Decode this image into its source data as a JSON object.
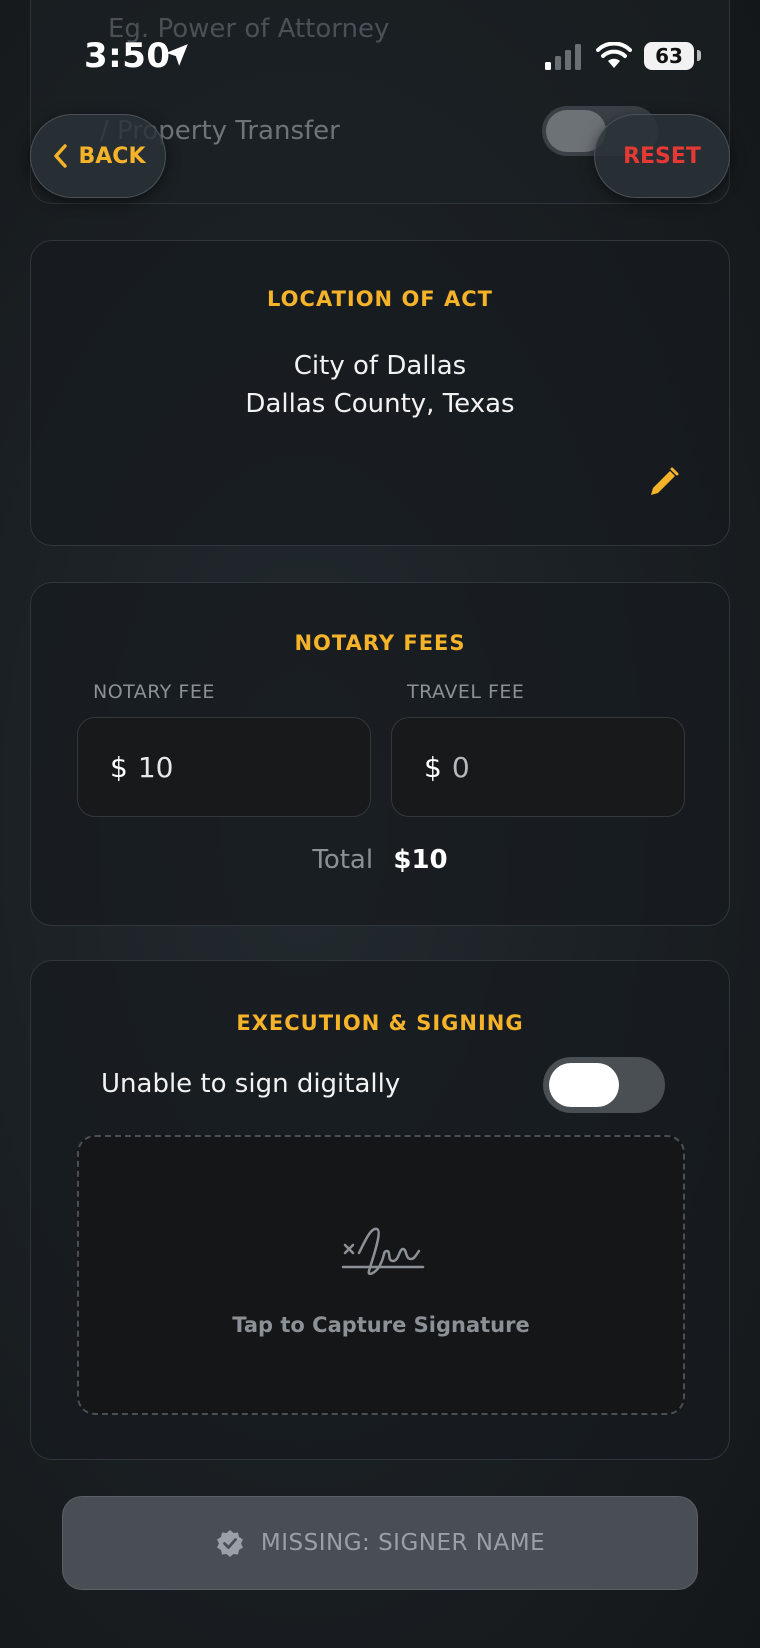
{
  "status_bar": {
    "time": "3:50",
    "battery": "63"
  },
  "background_form": {
    "placeholder": "Eg. Power of Attorney",
    "row_label": "/ Property Transfer"
  },
  "header": {
    "back_label": "BACK",
    "reset_label": "RESET"
  },
  "location": {
    "title": "LOCATION OF ACT",
    "city": "City of Dallas",
    "county_state": "Dallas County, Texas"
  },
  "fees": {
    "title": "NOTARY FEES",
    "notary_fee_label": "NOTARY FEE",
    "travel_fee_label": "TRAVEL FEE",
    "currency": "$",
    "notary_fee_value": "10",
    "travel_fee_placeholder": "0",
    "total_label": "Total",
    "total_value": "$10"
  },
  "execution": {
    "title": "EXECUTION & SIGNING",
    "toggle_label": "Unable to sign digitally",
    "toggle_on": false,
    "signature_prompt": "Tap to Capture Signature"
  },
  "footer": {
    "status_label": "MISSING: SIGNER NAME"
  },
  "colors": {
    "accent": "#f5b32a",
    "danger": "#e53935",
    "background": "#1a1f23"
  }
}
